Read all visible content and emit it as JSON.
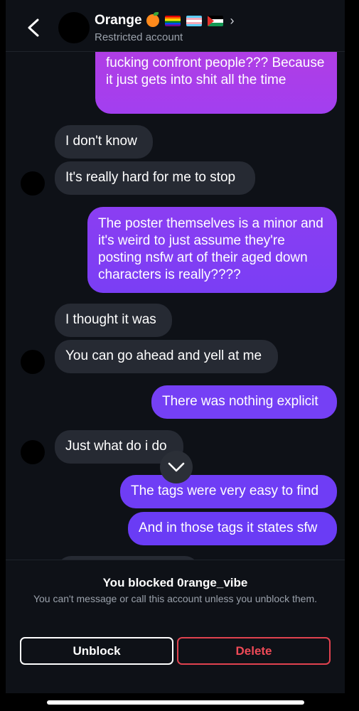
{
  "header": {
    "contact_name": "Orange",
    "subtitle": "Restricted account",
    "emoji_icons": [
      "orange-emoji",
      "rainbow-flag",
      "transgender-flag",
      "palestine-flag"
    ]
  },
  "messages": [
    {
      "side": "out",
      "text": "fucking confront people??? Because it just gets into shit all the time"
    },
    {
      "side": "in",
      "text": "I don't know"
    },
    {
      "side": "in",
      "text": "It's really hard for me to stop"
    },
    {
      "side": "out",
      "text": "The poster themselves is a minor and it's weird to just assume they're posting nsfw art of their aged down characters is really????"
    },
    {
      "side": "in",
      "text": "I thought it was"
    },
    {
      "side": "in",
      "text": "You can go ahead and yell at me"
    },
    {
      "side": "out",
      "text": "There was nothing explicit"
    },
    {
      "side": "in",
      "text": "Just what do i do"
    },
    {
      "side": "out",
      "text": "The tags were very easy to find"
    },
    {
      "side": "out",
      "text": "And in those tags it states sfw"
    }
  ],
  "footer": {
    "title": "You blocked 0range_vibe",
    "subtitle": "You can't message or call this account unless you unblock them.",
    "unblock_label": "Unblock",
    "delete_label": "Delete"
  },
  "colors": {
    "background": "#0e1117",
    "incoming_bubble": "#262a33",
    "outgoing_purple": "#a43ff0",
    "outgoing_violet": "#6f3df5",
    "delete_red": "#e0424f"
  }
}
